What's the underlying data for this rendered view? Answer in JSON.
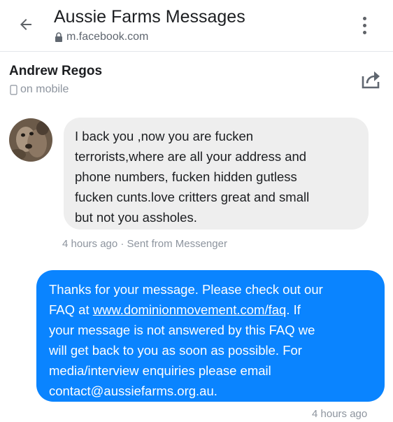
{
  "browser": {
    "title": "Aussie Farms Messages",
    "url": "m.facebook.com",
    "back_icon": "arrow-left-icon",
    "menu_icon": "more-vertical-icon",
    "lock_icon": "lock-icon"
  },
  "conversation": {
    "sender_name": "Andrew Regos",
    "sender_status": "on mobile",
    "status_icon": "phone-icon",
    "share_icon": "share-icon"
  },
  "messages": [
    {
      "direction": "incoming",
      "lines": [
        "I back you ,now you are fucken",
        "terrorists,where are all your address and",
        "phone numbers, fucken hidden gutless",
        "fucken cunts.love critters great and small",
        "but not you assholes."
      ],
      "meta": "4 hours ago · Sent from Messenger"
    },
    {
      "direction": "outgoing",
      "line1": "Thanks for your message. Please check out our",
      "line2_prefix": "FAQ at ",
      "link": "www.dominionmovement.com/faq",
      "line2_suffix": ". If",
      "line3": "your message is not answered by this FAQ we",
      "line4": "will get back to you as soon as possible. For",
      "line5": "media/interview enquiries please email",
      "line6": "contact@aussiefarms.org.au.",
      "meta": "4 hours ago"
    }
  ],
  "colors": {
    "outgoing_bubble": "#0a84ff",
    "incoming_bubble": "#eeeeee",
    "meta_text": "#8d949e"
  }
}
